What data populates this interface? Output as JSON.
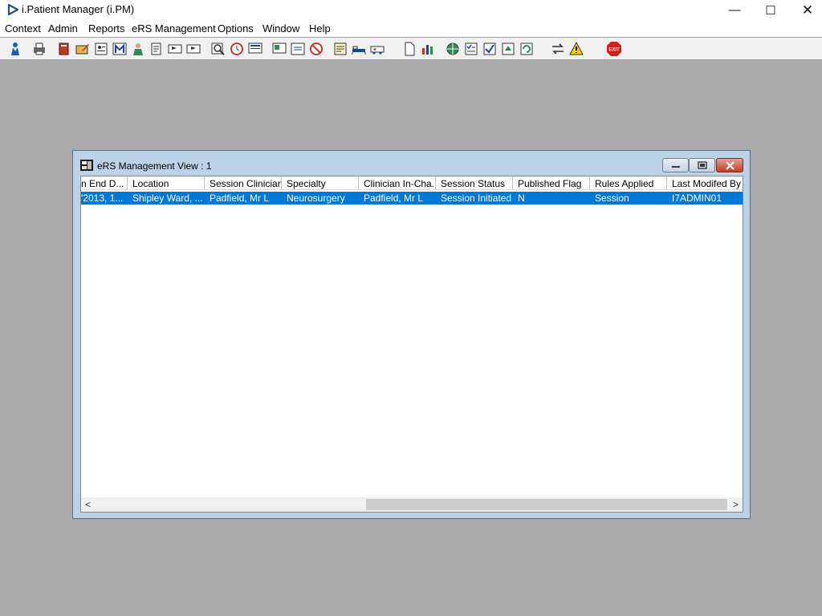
{
  "window": {
    "title": "i.Patient Manager (i.PM)",
    "controls": {
      "minimize": "—",
      "maximize": "☐",
      "close": "✕"
    }
  },
  "menu": [
    "Context",
    "Admin",
    "Reports",
    "eRS Management",
    "Options",
    "Window",
    "Help"
  ],
  "toolbar": {
    "icons": [
      "person-icon",
      "printer-icon",
      "book-icon",
      "folder-edit-icon",
      "patient-record-icon",
      "m-icon",
      "doctor-icon",
      "notepad-icon",
      "flag-icon",
      "flag-alt-icon",
      "search-icon",
      "clock-icon",
      "monitor-icon",
      "screen-icon",
      "form-icon",
      "no-entry-icon",
      "note-icon",
      "bed-icon",
      "ambulance-icon",
      "document-icon",
      "chart-icon",
      "globe-icon",
      "checklist-icon",
      "check-icon",
      "green-arrows-icon",
      "refresh-icon",
      "swap-icon",
      "warning-icon",
      "exit-icon"
    ],
    "exit_label": "EXIT"
  },
  "child_window": {
    "title": "eRS Management View : 1",
    "columns": [
      "n End D...",
      "Location",
      "Session Clinician",
      "Specialty",
      "Clinician In-Cha...",
      "Session Status",
      "Published Flag",
      "Rules Applied",
      "Last Modifed By"
    ],
    "rows": [
      [
        "'2013, 1...",
        "Shipley Ward, ...",
        "Padfield, Mr L",
        "Neurosurgery",
        "Padfield, Mr L",
        "Session Initiated",
        "N",
        "Session",
        "I7ADMIN01"
      ]
    ],
    "scroll_left": "<",
    "scroll_right": ">"
  },
  "colors": {
    "selection": "#0078d7",
    "desktop": "#ababab",
    "mdi_frame": "#bcd2e6"
  }
}
